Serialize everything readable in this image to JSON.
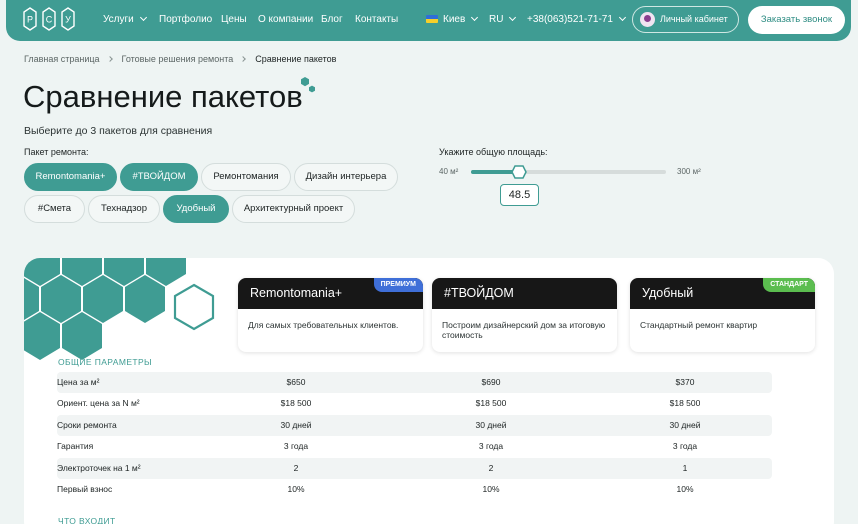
{
  "header": {
    "logo_letters": [
      "Р",
      "С",
      "У"
    ],
    "nav": [
      {
        "label": "Услуги",
        "has_dropdown": true
      },
      {
        "label": "Портфолио",
        "has_dropdown": false
      },
      {
        "label": "Цены",
        "has_dropdown": false
      },
      {
        "label": "О компании",
        "has_dropdown": false
      },
      {
        "label": "Блог",
        "has_dropdown": false
      },
      {
        "label": "Контакты",
        "has_dropdown": false
      }
    ],
    "city": "Киев",
    "language": "RU",
    "phone": "+38(063)521-71-71",
    "cabinet_label": "Личный кабинет",
    "call_label": "Заказать звонок",
    "accent_color": "#3f9c93"
  },
  "breadcrumb": [
    "Главная страница",
    "Готовые решения ремонта",
    "Сравнение пакетов"
  ],
  "page_title": "Сравнение пакетов",
  "subtitle": "Выберите до 3 пакетов для сравнения",
  "packages": {
    "label": "Пакет ремонта:",
    "chips": [
      {
        "label": "Remontomania+",
        "selected": true
      },
      {
        "label": "#ТВОЙДОМ",
        "selected": true
      },
      {
        "label": "Ремонтомания",
        "selected": false
      },
      {
        "label": "Дизайн интерьера",
        "selected": false
      },
      {
        "label": "#Смета",
        "selected": false
      },
      {
        "label": "Технадзор",
        "selected": false
      },
      {
        "label": "Удобный",
        "selected": true
      },
      {
        "label": "Архитектурный проект",
        "selected": false
      }
    ]
  },
  "area": {
    "label": "Укажите общую площадь:",
    "min_label": "40 м²",
    "max_label": "300 м²",
    "min": 40,
    "max": 300,
    "value": 48.5,
    "value_text": "48.5"
  },
  "compare": {
    "cards": [
      {
        "name": "Remontomania+",
        "badge": "ПРЕМИУМ",
        "badge_color": "#3f6fd8",
        "description": "Для самых требовательных клиентов."
      },
      {
        "name": "#ТВОЙДОМ",
        "badge": "",
        "badge_color": "",
        "description": "Построим дизайнерский дом за итоговую стоимость"
      },
      {
        "name": "Удобный",
        "badge": "СТАНДАРТ",
        "badge_color": "#5bbd4f",
        "description": "Стандартный ремонт квартир"
      }
    ],
    "section_general": "ОБЩИЕ ПАРАМЕТРЫ",
    "rows": [
      {
        "label": "Цена за м²",
        "values": [
          "$650",
          "$690",
          "$370"
        ]
      },
      {
        "label": "Ориент. цена за N м²",
        "values": [
          "$18 500",
          "$18 500",
          "$18 500"
        ]
      },
      {
        "label": "Сроки ремонта",
        "values": [
          "30 дней",
          "30 дней",
          "30 дней"
        ]
      },
      {
        "label": "Гарантия",
        "values": [
          "3 года",
          "3 года",
          "3 года"
        ]
      },
      {
        "label": "Электроточек на 1 м²",
        "values": [
          "2",
          "2",
          "1"
        ]
      },
      {
        "label": "Первый взнос",
        "values": [
          "10%",
          "10%",
          "10%"
        ]
      }
    ],
    "section_included": "ЧТО ВХОДИТ"
  }
}
